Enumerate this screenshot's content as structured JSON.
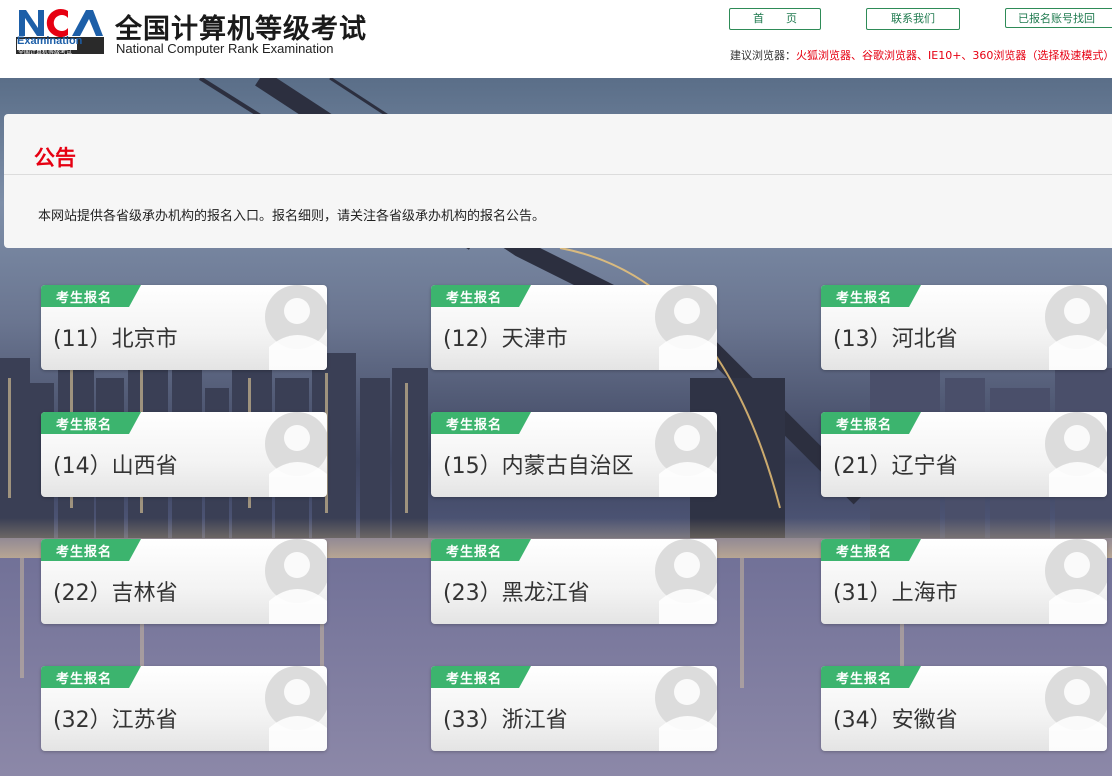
{
  "header": {
    "logo_word": "Examination",
    "logo_tagline": "全国计算机等级考试",
    "title": "全国计算机等级考试",
    "subtitle": "National Computer Rank Examination",
    "nav": [
      {
        "label": "首　　页"
      },
      {
        "label": "联系我们"
      },
      {
        "label": "已报名账号找回"
      }
    ],
    "browser_tip_prefix": "建议浏览器：",
    "browser_tip_browsers": "火狐浏览器、谷歌浏览器、IE10+、360浏览器（选择极速模式）"
  },
  "notice": {
    "title": "公告",
    "text": "本网站提供各省级承办机构的报名入口。报名细则，请关注各省级承办机构的报名公告。"
  },
  "card_tag": "考生报名",
  "provinces": [
    {
      "label": "(11）北京市"
    },
    {
      "label": "(12）天津市"
    },
    {
      "label": "(13）河北省"
    },
    {
      "label": "(14）山西省"
    },
    {
      "label": "(15）内蒙古自治区"
    },
    {
      "label": "(21）辽宁省"
    },
    {
      "label": "(22）吉林省"
    },
    {
      "label": "(23）黑龙江省"
    },
    {
      "label": "(31）上海市"
    },
    {
      "label": "(32）江苏省"
    },
    {
      "label": "(33）浙江省"
    },
    {
      "label": "(34）安徽省"
    }
  ],
  "colors": {
    "accent_green": "#3cb46e",
    "notice_red": "#e60012",
    "logo_red": "#e60012",
    "logo_blue": "#1d5fa8"
  },
  "icons": {
    "card_avatar": "person-silhouette-icon"
  }
}
